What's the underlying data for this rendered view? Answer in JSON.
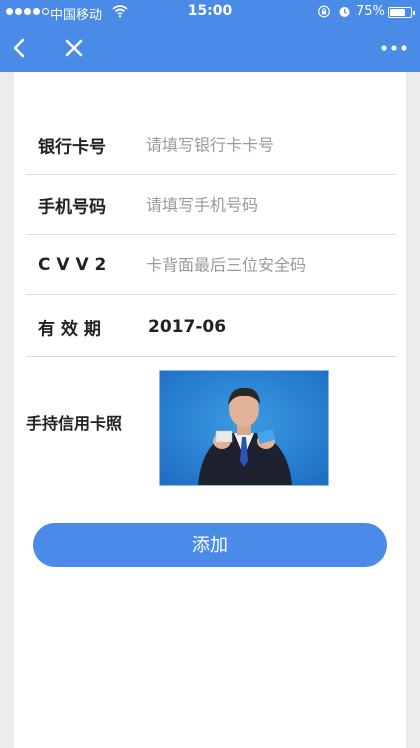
{
  "status_bar": {
    "carrier": "中国移动",
    "time": "15:00",
    "battery": "75%",
    "battery_level": 0.75
  },
  "nav": {
    "back_icon": "chevron-left-icon",
    "close_icon": "close-icon",
    "more_icon": "more-dots-icon"
  },
  "form": {
    "card_number": {
      "label": "银行卡号",
      "placeholder": "请填写银行卡卡号",
      "value": ""
    },
    "phone": {
      "label": "手机号码",
      "placeholder": "请填写手机号码",
      "value": ""
    },
    "cvv": {
      "label": "C V V 2",
      "placeholder": "卡背面最后三位安全码",
      "value": ""
    },
    "expiry": {
      "label": "有 效 期",
      "value": "2017-06"
    },
    "photo": {
      "label": "手持信用卡照"
    }
  },
  "submit": {
    "label": "添加"
  },
  "colors": {
    "accent": "#4a8be8",
    "background": "#ececec",
    "card": "#ffffff",
    "photo_bg": "#2a7fd0"
  }
}
